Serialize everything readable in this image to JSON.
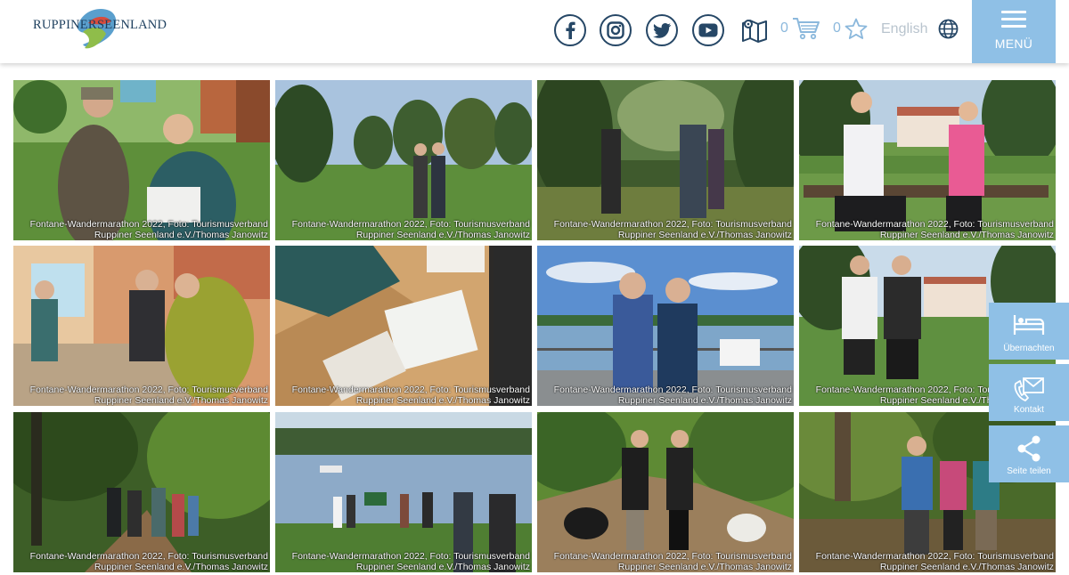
{
  "header": {
    "logo": {
      "left": "RUPPINER",
      "right": "SEENLAND"
    },
    "social": [
      {
        "name": "facebook-icon"
      },
      {
        "name": "instagram-icon"
      },
      {
        "name": "twitter-icon"
      },
      {
        "name": "youtube-icon"
      }
    ],
    "cart_count": "0",
    "favorites_count": "0",
    "language": "English",
    "menu_label": "MENÜ"
  },
  "gallery": [
    {
      "caption1": "Fontane-Wandermarathon 2022, Foto: Tourismusverband",
      "caption2": "Ruppiner Seenland e.V./Thomas Janowitz"
    },
    {
      "caption1": "Fontane-Wandermarathon 2022, Foto: Tourismusverband",
      "caption2": "Ruppiner Seenland e.V./Thomas Janowitz"
    },
    {
      "caption1": "Fontane-Wandermarathon 2022, Foto: Tourismusverband",
      "caption2": "Ruppiner Seenland e.V./Thomas Janowitz"
    },
    {
      "caption1": "Fontane-Wandermarathon 2022, Foto: Tourismusverband",
      "caption2": "Ruppiner Seenland e.V./Thomas Janowitz"
    },
    {
      "caption1": "Fontane-Wandermarathon 2022, Foto: Tourismusverband",
      "caption2": "Ruppiner Seenland e.V./Thomas Janowitz"
    },
    {
      "caption1": "Fontane-Wandermarathon 2022, Foto: Tourismusverband",
      "caption2": "Ruppiner Seenland e.V./Thomas Janowitz"
    },
    {
      "caption1": "Fontane-Wandermarathon 2022, Foto: Tourismusverband",
      "caption2": "Ruppiner Seenland e.V./Thomas Janowitz"
    },
    {
      "caption1": "Fontane-Wandermarathon 2022, Foto: Tourismusverband",
      "caption2": "Ruppiner Seenland e.V./Thomas Janowitz"
    },
    {
      "caption1": "Fontane-Wandermarathon 2022, Foto: Tourismusverband",
      "caption2": "Ruppiner Seenland e.V./Thomas Janowitz"
    },
    {
      "caption1": "Fontane-Wandermarathon 2022, Foto: Tourismusverband",
      "caption2": "Ruppiner Seenland e.V./Thomas Janowitz"
    },
    {
      "caption1": "Fontane-Wandermarathon 2022, Foto: Tourismusverband",
      "caption2": "Ruppiner Seenland e.V./Thomas Janowitz"
    },
    {
      "caption1": "Fontane-Wandermarathon 2022, Foto: Tourismusverband",
      "caption2": "Ruppiner Seenland e.V./Thomas Janowitz"
    }
  ],
  "side": {
    "overnight": "Übernachten",
    "contact": "Kontakt",
    "share": "Seite teilen"
  },
  "colors": {
    "accent": "#8fc0e6",
    "navy": "#264766",
    "count_blue": "#8bb8dc"
  }
}
